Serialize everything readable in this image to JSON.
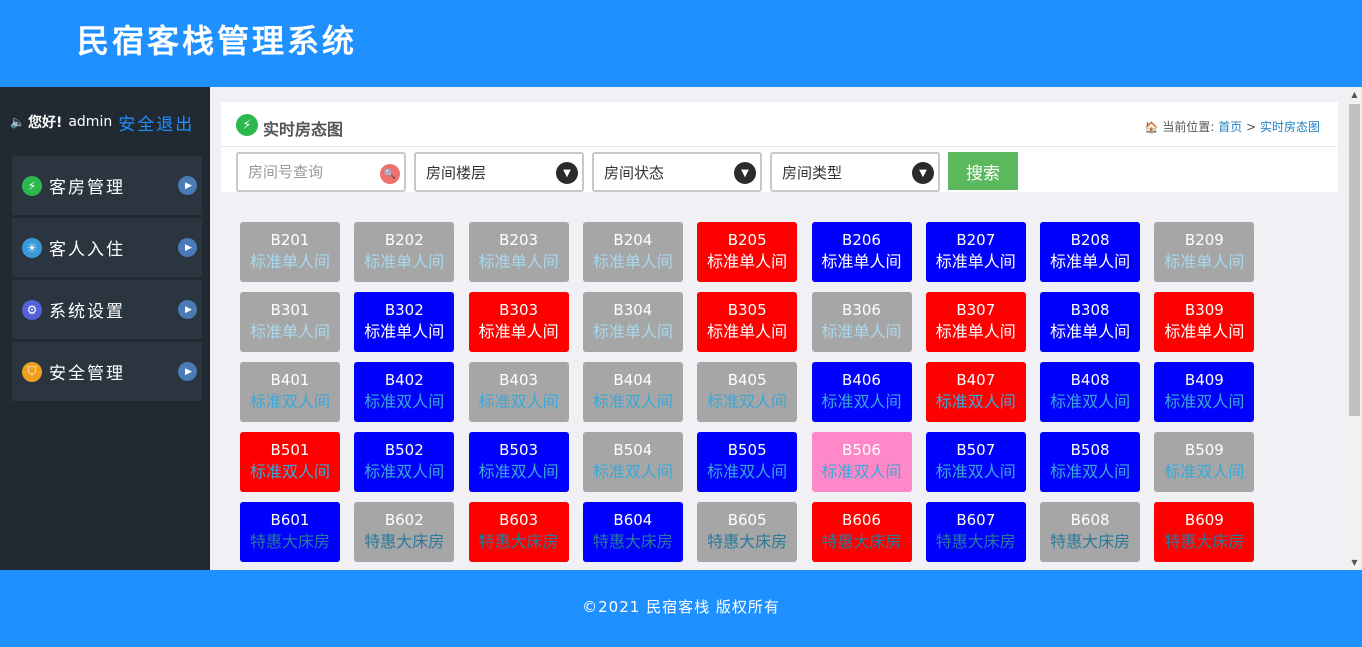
{
  "app": {
    "title": "民宿客栈管理系统"
  },
  "colors": {
    "header": "#1e90ff",
    "sidebar": "#212a33",
    "free": "#a6a6a6",
    "occupied": "#ff0000",
    "reserved": "#0000ff",
    "cleaning": "#ff88c8",
    "search_button": "#5cb85c"
  },
  "user": {
    "greeting": "您好!",
    "name": "admin",
    "logout": "安全退出"
  },
  "menu": [
    {
      "label": "客房管理",
      "icon": "lightning-icon",
      "icon_color": "#2db84d",
      "glyph": "⚡"
    },
    {
      "label": "客人入住",
      "icon": "lightbulb-icon",
      "icon_color": "#3a9ad9",
      "glyph": "☀"
    },
    {
      "label": "系统设置",
      "icon": "gears-icon",
      "icon_color": "#5560d8",
      "glyph": "⚙"
    },
    {
      "label": "安全管理",
      "icon": "shield-icon",
      "icon_color": "#f0a020",
      "glyph": "⛉"
    }
  ],
  "panel": {
    "title": "实时房态图",
    "breadcrumb": {
      "prefix": "当前位置:",
      "home": "首页",
      "separator": ">",
      "current": "实时房态图"
    }
  },
  "filters": {
    "room_search_placeholder": "房间号查询",
    "floor": "房间楼层",
    "status": "房间状态",
    "type": "房间类型",
    "search_button": "搜索"
  },
  "rooms": [
    [
      {
        "no": "B201",
        "type": "标准单人间",
        "bg": "#a6a6a6",
        "tc": "#a8d8f0"
      },
      {
        "no": "B202",
        "type": "标准单人间",
        "bg": "#a6a6a6",
        "tc": "#a8d8f0"
      },
      {
        "no": "B203",
        "type": "标准单人间",
        "bg": "#a6a6a6",
        "tc": "#a8d8f0"
      },
      {
        "no": "B204",
        "type": "标准单人间",
        "bg": "#a6a6a6",
        "tc": "#a8d8f0"
      },
      {
        "no": "B205",
        "type": "标准单人间",
        "bg": "#ff0000",
        "tc": "#ffffff"
      },
      {
        "no": "B206",
        "type": "标准单人间",
        "bg": "#0000ff",
        "tc": "#ffffff"
      },
      {
        "no": "B207",
        "type": "标准单人间",
        "bg": "#0000ff",
        "tc": "#ffffff"
      },
      {
        "no": "B208",
        "type": "标准单人间",
        "bg": "#0000ff",
        "tc": "#ffffff"
      },
      {
        "no": "B209",
        "type": "标准单人间",
        "bg": "#a6a6a6",
        "tc": "#a8d8f0"
      }
    ],
    [
      {
        "no": "B301",
        "type": "标准单人间",
        "bg": "#a6a6a6",
        "tc": "#a8d8f0"
      },
      {
        "no": "B302",
        "type": "标准单人间",
        "bg": "#0000ff",
        "tc": "#ffffff"
      },
      {
        "no": "B303",
        "type": "标准单人间",
        "bg": "#ff0000",
        "tc": "#ffffff"
      },
      {
        "no": "B304",
        "type": "标准单人间",
        "bg": "#a6a6a6",
        "tc": "#a8d8f0"
      },
      {
        "no": "B305",
        "type": "标准单人间",
        "bg": "#ff0000",
        "tc": "#ffffff"
      },
      {
        "no": "B306",
        "type": "标准单人间",
        "bg": "#a6a6a6",
        "tc": "#a8d8f0"
      },
      {
        "no": "B307",
        "type": "标准单人间",
        "bg": "#ff0000",
        "tc": "#ffffff"
      },
      {
        "no": "B308",
        "type": "标准单人间",
        "bg": "#0000ff",
        "tc": "#ffffff"
      },
      {
        "no": "B309",
        "type": "标准单人间",
        "bg": "#ff0000",
        "tc": "#ffffff"
      }
    ],
    [
      {
        "no": "B401",
        "type": "标准双人间",
        "bg": "#a6a6a6",
        "tc": "#3aa8d8"
      },
      {
        "no": "B402",
        "type": "标准双人间",
        "bg": "#0000ff",
        "tc": "#3aa8d8"
      },
      {
        "no": "B403",
        "type": "标准双人间",
        "bg": "#a6a6a6",
        "tc": "#3aa8d8"
      },
      {
        "no": "B404",
        "type": "标准双人间",
        "bg": "#a6a6a6",
        "tc": "#3aa8d8"
      },
      {
        "no": "B405",
        "type": "标准双人间",
        "bg": "#a6a6a6",
        "tc": "#3aa8d8"
      },
      {
        "no": "B406",
        "type": "标准双人间",
        "bg": "#0000ff",
        "tc": "#3aa8d8"
      },
      {
        "no": "B407",
        "type": "标准双人间",
        "bg": "#ff0000",
        "tc": "#3aa8d8"
      },
      {
        "no": "B408",
        "type": "标准双人间",
        "bg": "#0000ff",
        "tc": "#3aa8d8"
      },
      {
        "no": "B409",
        "type": "标准双人间",
        "bg": "#0000ff",
        "tc": "#3aa8d8"
      }
    ],
    [
      {
        "no": "B501",
        "type": "标准双人间",
        "bg": "#ff0000",
        "tc": "#3aa8d8"
      },
      {
        "no": "B502",
        "type": "标准双人间",
        "bg": "#0000ff",
        "tc": "#3aa8d8"
      },
      {
        "no": "B503",
        "type": "标准双人间",
        "bg": "#0000ff",
        "tc": "#3aa8d8"
      },
      {
        "no": "B504",
        "type": "标准双人间",
        "bg": "#a6a6a6",
        "tc": "#3aa8d8"
      },
      {
        "no": "B505",
        "type": "标准双人间",
        "bg": "#0000ff",
        "tc": "#3aa8d8"
      },
      {
        "no": "B506",
        "type": "标准双人间",
        "bg": "#ff88c8",
        "tc": "#3aa8d8"
      },
      {
        "no": "B507",
        "type": "标准双人间",
        "bg": "#0000ff",
        "tc": "#3aa8d8"
      },
      {
        "no": "B508",
        "type": "标准双人间",
        "bg": "#0000ff",
        "tc": "#3aa8d8"
      },
      {
        "no": "B509",
        "type": "标准双人间",
        "bg": "#a6a6a6",
        "tc": "#3aa8d8"
      }
    ],
    [
      {
        "no": "B601",
        "type": "特惠大床房",
        "bg": "#0000ff",
        "tc": "#2a7a9a"
      },
      {
        "no": "B602",
        "type": "特惠大床房",
        "bg": "#a6a6a6",
        "tc": "#2a7a9a"
      },
      {
        "no": "B603",
        "type": "特惠大床房",
        "bg": "#ff0000",
        "tc": "#2a7a9a"
      },
      {
        "no": "B604",
        "type": "特惠大床房",
        "bg": "#0000ff",
        "tc": "#2a7a9a"
      },
      {
        "no": "B605",
        "type": "特惠大床房",
        "bg": "#a6a6a6",
        "tc": "#2a7a9a"
      },
      {
        "no": "B606",
        "type": "特惠大床房",
        "bg": "#ff0000",
        "tc": "#2a7a9a"
      },
      {
        "no": "B607",
        "type": "特惠大床房",
        "bg": "#0000ff",
        "tc": "#2a7a9a"
      },
      {
        "no": "B608",
        "type": "特惠大床房",
        "bg": "#a6a6a6",
        "tc": "#2a7a9a"
      },
      {
        "no": "B609",
        "type": "特惠大床房",
        "bg": "#ff0000",
        "tc": "#2a7a9a"
      }
    ]
  ],
  "footer": {
    "copyright": "©2021 民宿客栈 版权所有"
  }
}
